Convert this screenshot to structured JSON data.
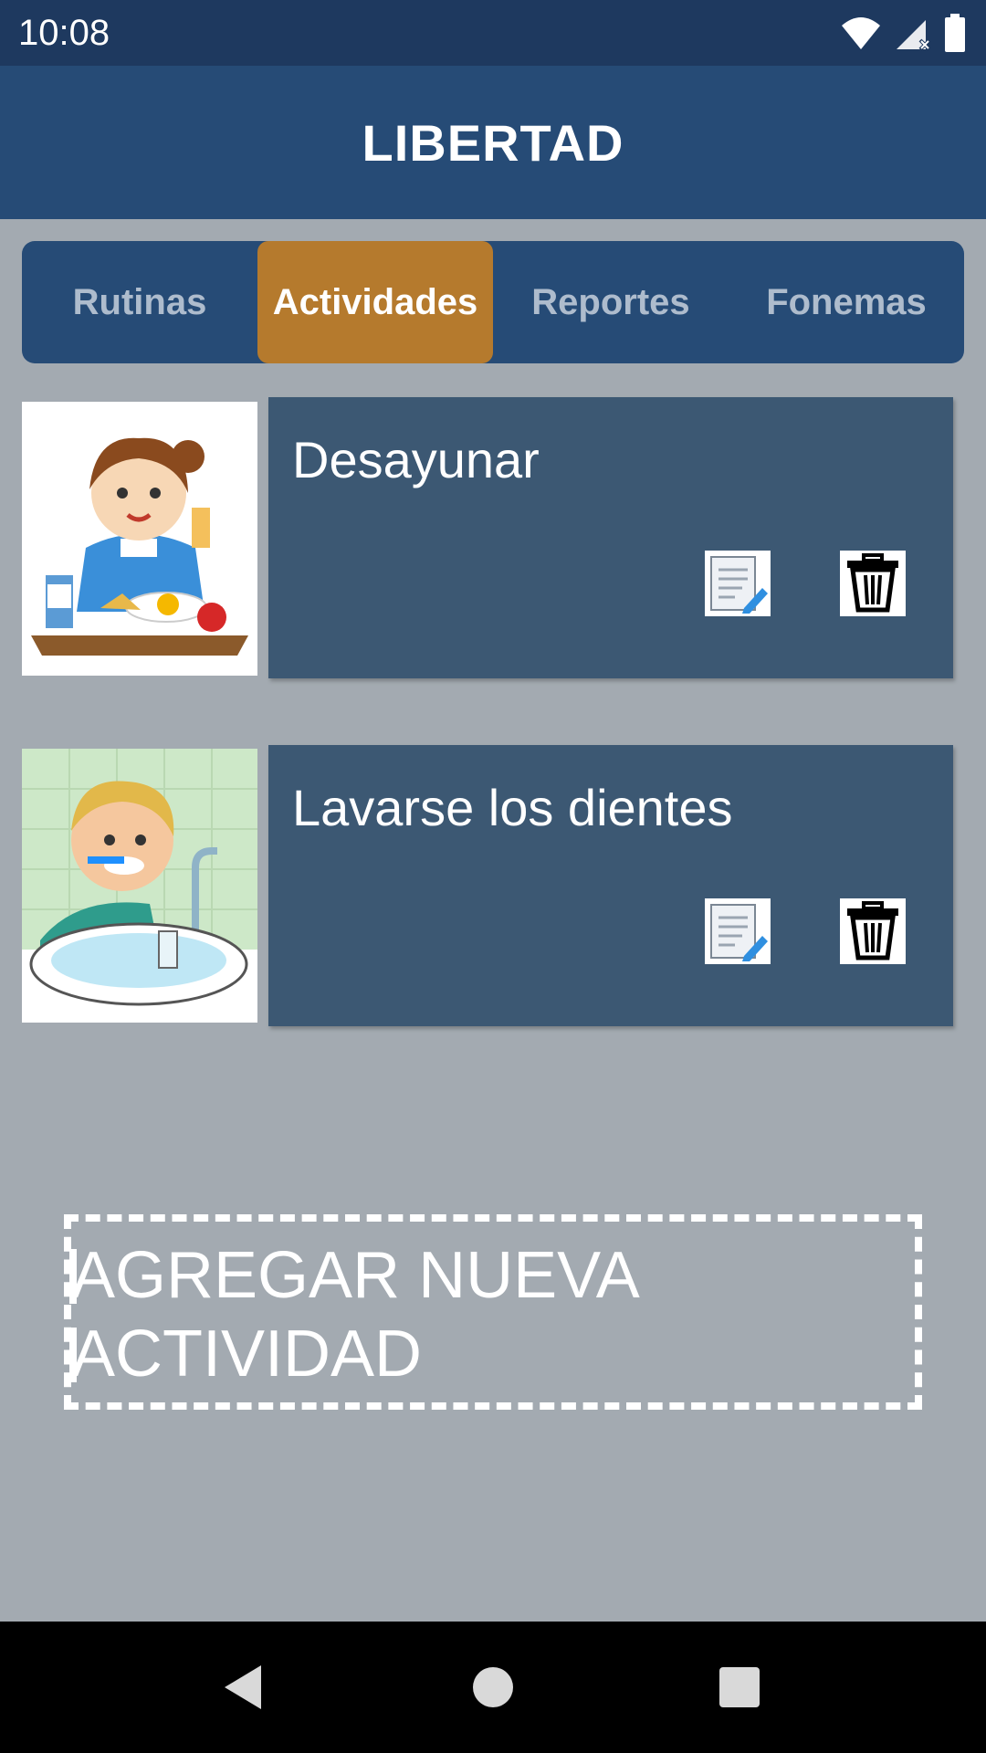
{
  "status_bar": {
    "time": "10:08"
  },
  "app_bar": {
    "title": "LIBERTAD"
  },
  "tabs": [
    {
      "label": "Rutinas",
      "active": false
    },
    {
      "label": "Actividades",
      "active": true
    },
    {
      "label": "Reportes",
      "active": false
    },
    {
      "label": "Fonemas",
      "active": false
    }
  ],
  "activities": [
    {
      "title": "Desayunar",
      "image": "girl-eating-breakfast-illustration"
    },
    {
      "title": "Lavarse los dientes",
      "image": "boy-brushing-teeth-illustration"
    }
  ],
  "add_button": {
    "label": "AGREGAR NUEVA ACTIVIDAD"
  },
  "icons": {
    "edit": "edit-document-icon",
    "delete": "trash-icon",
    "nav_back": "triangle-back-icon",
    "nav_home": "circle-home-icon",
    "nav_recents": "square-recents-icon"
  },
  "colors": {
    "status_bar": "#1e395f",
    "app_bar": "#264b76",
    "active_tab": "#b57a2d",
    "card": "#3c5873",
    "background": "#a3aab1"
  }
}
